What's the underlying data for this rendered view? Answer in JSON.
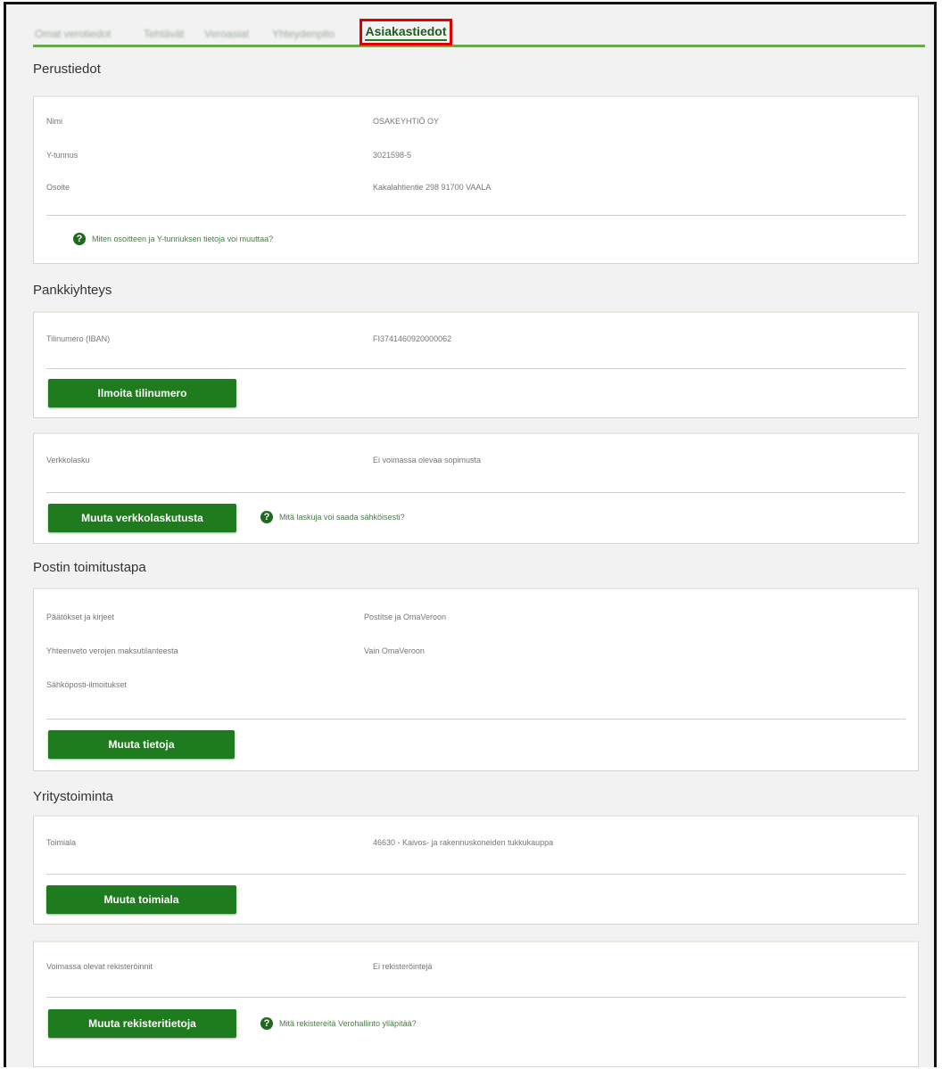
{
  "tabs": [
    {
      "label": "Omat verotiedot"
    },
    {
      "label": "Tehtävät"
    },
    {
      "label": "Veroasiat"
    },
    {
      "label": "Yhteydenpito"
    }
  ],
  "active_tab": "Asiakastiedot",
  "perustiedot": {
    "title": "Perustiedot",
    "rows": [
      {
        "label": "Nimi",
        "value": "OSAKEYHTIÖ OY"
      },
      {
        "label": "Y-tunnus",
        "value": "3021598-5"
      },
      {
        "label": "Osoite",
        "value": "Kakalahtientie 298 91700 VAALA"
      }
    ],
    "help": "Miten osoitteen ja Y-tunnuksen tietoja voi muuttaa?"
  },
  "pankkiyhteys": {
    "title": "Pankkiyhteys",
    "iban_label": "Tilinumero (IBAN)",
    "iban_value": "FI3741460920000062",
    "button": "Ilmoita tilinumero",
    "verkkolasku_label": "Verkkolasku",
    "verkkolasku_value": "Ei voimassa olevaa sopimusta",
    "verkkolasku_button": "Muuta verkkolaskutusta",
    "verkkolasku_help": "Mitä laskuja voi saada sähköisesti?"
  },
  "posti": {
    "title": "Postin toimitustapa",
    "rows": [
      {
        "label": "Päätökset ja kirjeet",
        "value": "Postitse ja OmaVeroon"
      },
      {
        "label": "Yhteenveto verojen maksutilanteesta",
        "value": "Vain OmaVeroon"
      },
      {
        "label": "Sähköposti-ilmoitukset",
        "value": ""
      }
    ],
    "button": "Muuta tietoja"
  },
  "yritystoiminta": {
    "title": "Yritystoiminta",
    "toimiala_label": "Toimiala",
    "toimiala_value": "46630 - Kaivos- ja rakennuskoneiden tukkukauppa",
    "toimiala_button": "Muuta toimiala",
    "rek_label": "Voimassa olevat rekisteröinnit",
    "rek_value": "Ei rekisteröintejä",
    "rek_button": "Muuta rekisteritietoja",
    "rek_help": "Mitä rekistereitä Verohallinto ylläpitää?"
  },
  "colors": {
    "accent": "#1e7b1e",
    "highlight": "#e00000",
    "tab_line": "#6aa84f"
  }
}
